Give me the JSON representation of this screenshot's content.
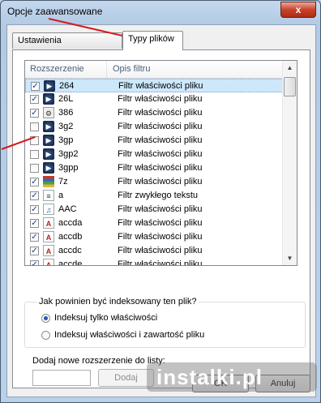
{
  "window": {
    "title": "Opcje zaawansowane",
    "close_glyph": "x"
  },
  "tabs": [
    {
      "label": "Ustawienia indeksowania"
    },
    {
      "label": "Typy plików"
    }
  ],
  "list": {
    "columns": [
      "Rozszerzenie",
      "Opis filtru"
    ],
    "rows": [
      {
        "ext": "264",
        "desc": "Filtr właściwości pliku",
        "checked": true,
        "icon": "media-icon",
        "selected": true
      },
      {
        "ext": "26L",
        "desc": "Filtr właściwości pliku",
        "checked": true,
        "icon": "media-icon"
      },
      {
        "ext": "386",
        "desc": "Filtr właściwości pliku",
        "checked": true,
        "icon": "gear-file-icon"
      },
      {
        "ext": "3g2",
        "desc": "Filtr właściwości pliku",
        "checked": false,
        "icon": "media-icon"
      },
      {
        "ext": "3gp",
        "desc": "Filtr właściwości pliku",
        "checked": false,
        "icon": "media-icon"
      },
      {
        "ext": "3gp2",
        "desc": "Filtr właściwości pliku",
        "checked": false,
        "icon": "media-icon"
      },
      {
        "ext": "3gpp",
        "desc": "Filtr właściwości pliku",
        "checked": false,
        "icon": "media-icon"
      },
      {
        "ext": "7z",
        "desc": "Filtr właściwości pliku",
        "checked": true,
        "icon": "archive-icon"
      },
      {
        "ext": "a",
        "desc": "Filtr zwykłego tekstu",
        "checked": true,
        "icon": "document-icon"
      },
      {
        "ext": "AAC",
        "desc": "Filtr właściwości pliku",
        "checked": true,
        "icon": "audio-file-icon"
      },
      {
        "ext": "accda",
        "desc": "Filtr właściwości pliku",
        "checked": true,
        "icon": "access-file-icon"
      },
      {
        "ext": "accdb",
        "desc": "Filtr właściwości pliku",
        "checked": true,
        "icon": "access-file-icon"
      },
      {
        "ext": "accdc",
        "desc": "Filtr właściwości pliku",
        "checked": true,
        "icon": "access-file-icon"
      },
      {
        "ext": "accde",
        "desc": "Filtr właściwości pliku",
        "checked": true,
        "icon": "access-file-icon"
      }
    ]
  },
  "index_group": {
    "label": "Jak powinien być indeksowany ten plik?",
    "options": [
      {
        "label": "Indeksuj tylko właściwości",
        "selected": true
      },
      {
        "label": "Indeksuj właściwości i zawartość pliku",
        "selected": false
      }
    ]
  },
  "add": {
    "label": "Dodaj nowe rozszerzenie do listy:",
    "input_value": "",
    "button": "Dodaj"
  },
  "buttons": {
    "ok": "OK",
    "cancel": "Anuluj"
  },
  "watermark": "instalki.pl",
  "colors": {
    "annotation_arrow": "#d51a1a",
    "selection": "#cde8fb"
  }
}
